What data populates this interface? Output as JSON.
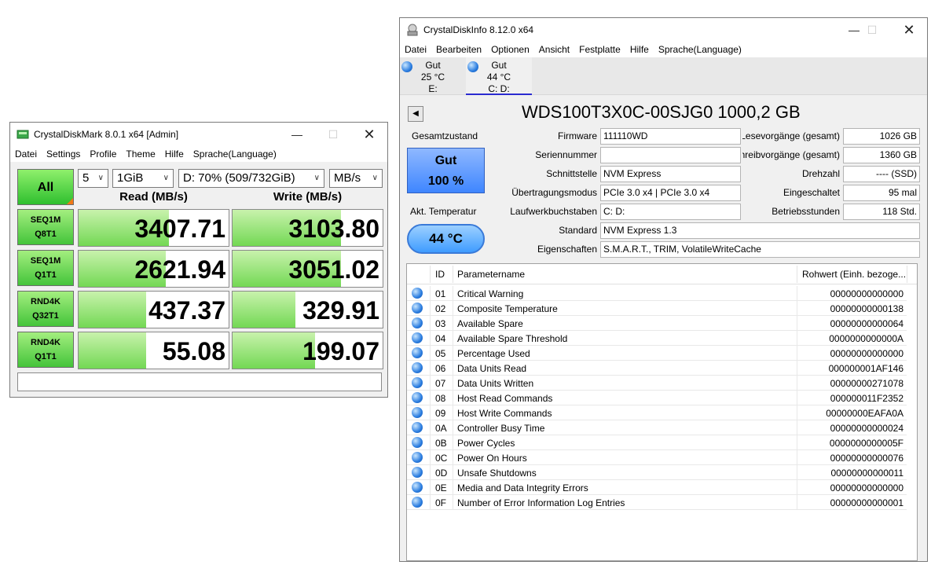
{
  "cdm": {
    "title": "CrystalDiskMark 8.0.1 x64 [Admin]",
    "menu": [
      "Datei",
      "Settings",
      "Profile",
      "Theme",
      "Hilfe",
      "Sprache(Language)"
    ],
    "all_label": "All",
    "count": "5",
    "size": "1GiB",
    "drive": "D: 70% (509/732GiB)",
    "unit": "MB/s",
    "read_header": "Read (MB/s)",
    "write_header": "Write (MB/s)",
    "tests": [
      {
        "line1": "SEQ1M",
        "line2": "Q8T1",
        "read": "3407.71",
        "write": "3103.80",
        "read_fill": 0.6,
        "write_fill": 0.72
      },
      {
        "line1": "SEQ1M",
        "line2": "Q1T1",
        "read": "2621.94",
        "write": "3051.02",
        "read_fill": 0.58,
        "write_fill": 0.72
      },
      {
        "line1": "RND4K",
        "line2": "Q32T1",
        "read": "437.37",
        "write": "329.91",
        "read_fill": 0.45,
        "write_fill": 0.42
      },
      {
        "line1": "RND4K",
        "line2": "Q1T1",
        "read": "55.08",
        "write": "199.07",
        "read_fill": 0.45,
        "write_fill": 0.55
      }
    ],
    "status": ""
  },
  "cdi": {
    "title": "CrystalDiskInfo 8.12.0 x64",
    "menu": [
      "Datei",
      "Bearbeiten",
      "Optionen",
      "Ansicht",
      "Festplatte",
      "Hilfe",
      "Sprache(Language)"
    ],
    "disks": [
      {
        "status": "Gut",
        "temp": "25 °C",
        "letter": "E:",
        "active": false
      },
      {
        "status": "Gut",
        "temp": "44 °C",
        "letter": "C: D:",
        "active": true
      }
    ],
    "model": "WDS100T3X0C-00SJG0 1000,2 GB",
    "health_label": "Gesamtzustand",
    "health_status": "Gut",
    "health_percent": "100 %",
    "temp_label": "Akt. Temperatur",
    "temp_value": "44 °C",
    "fields_left": [
      {
        "label": "Firmware",
        "value": "111110WD"
      },
      {
        "label": "Seriennummer",
        "value": ""
      },
      {
        "label": "Schnittstelle",
        "value": "NVM Express"
      },
      {
        "label": "Übertragungsmodus",
        "value": "PCIe 3.0 x4 | PCIe 3.0 x4"
      },
      {
        "label": "Laufwerkbuchstaben",
        "value": "C: D:"
      }
    ],
    "fields_right": [
      {
        "label": "Lesevorgänge (gesamt)",
        "value": "1026 GB"
      },
      {
        "label": "Schreibvorgänge (gesamt)",
        "value": "1360 GB"
      },
      {
        "label": "Drehzahl",
        "value": "---- (SSD)"
      },
      {
        "label": "Eingeschaltet",
        "value": "95 mal"
      },
      {
        "label": "Betriebsstunden",
        "value": "118 Std."
      }
    ],
    "standard_label": "Standard",
    "standard_value": "NVM Express 1.3",
    "features_label": "Eigenschaften",
    "features_value": "S.M.A.R.T., TRIM, VolatileWriteCache",
    "smart_headers": {
      "id": "ID",
      "name": "Parametername",
      "raw": "Rohwert (Einh. bezoge..."
    },
    "smart_rows": [
      {
        "id": "01",
        "name": "Critical Warning",
        "raw": "00000000000000"
      },
      {
        "id": "02",
        "name": "Composite Temperature",
        "raw": "00000000000138"
      },
      {
        "id": "03",
        "name": "Available Spare",
        "raw": "00000000000064"
      },
      {
        "id": "04",
        "name": "Available Spare Threshold",
        "raw": "0000000000000A"
      },
      {
        "id": "05",
        "name": "Percentage Used",
        "raw": "00000000000000"
      },
      {
        "id": "06",
        "name": "Data Units Read",
        "raw": "000000001AF146"
      },
      {
        "id": "07",
        "name": "Data Units Written",
        "raw": "00000000271078"
      },
      {
        "id": "08",
        "name": "Host Read Commands",
        "raw": "000000011F2352"
      },
      {
        "id": "09",
        "name": "Host Write Commands",
        "raw": "00000000EAFA0A"
      },
      {
        "id": "0A",
        "name": "Controller Busy Time",
        "raw": "00000000000024"
      },
      {
        "id": "0B",
        "name": "Power Cycles",
        "raw": "0000000000005F"
      },
      {
        "id": "0C",
        "name": "Power On Hours",
        "raw": "00000000000076"
      },
      {
        "id": "0D",
        "name": "Unsafe Shutdowns",
        "raw": "00000000000011"
      },
      {
        "id": "0E",
        "name": "Media and Data Integrity Errors",
        "raw": "00000000000000"
      },
      {
        "id": "0F",
        "name": "Number of Error Information Log Entries",
        "raw": "00000000000001"
      }
    ]
  }
}
